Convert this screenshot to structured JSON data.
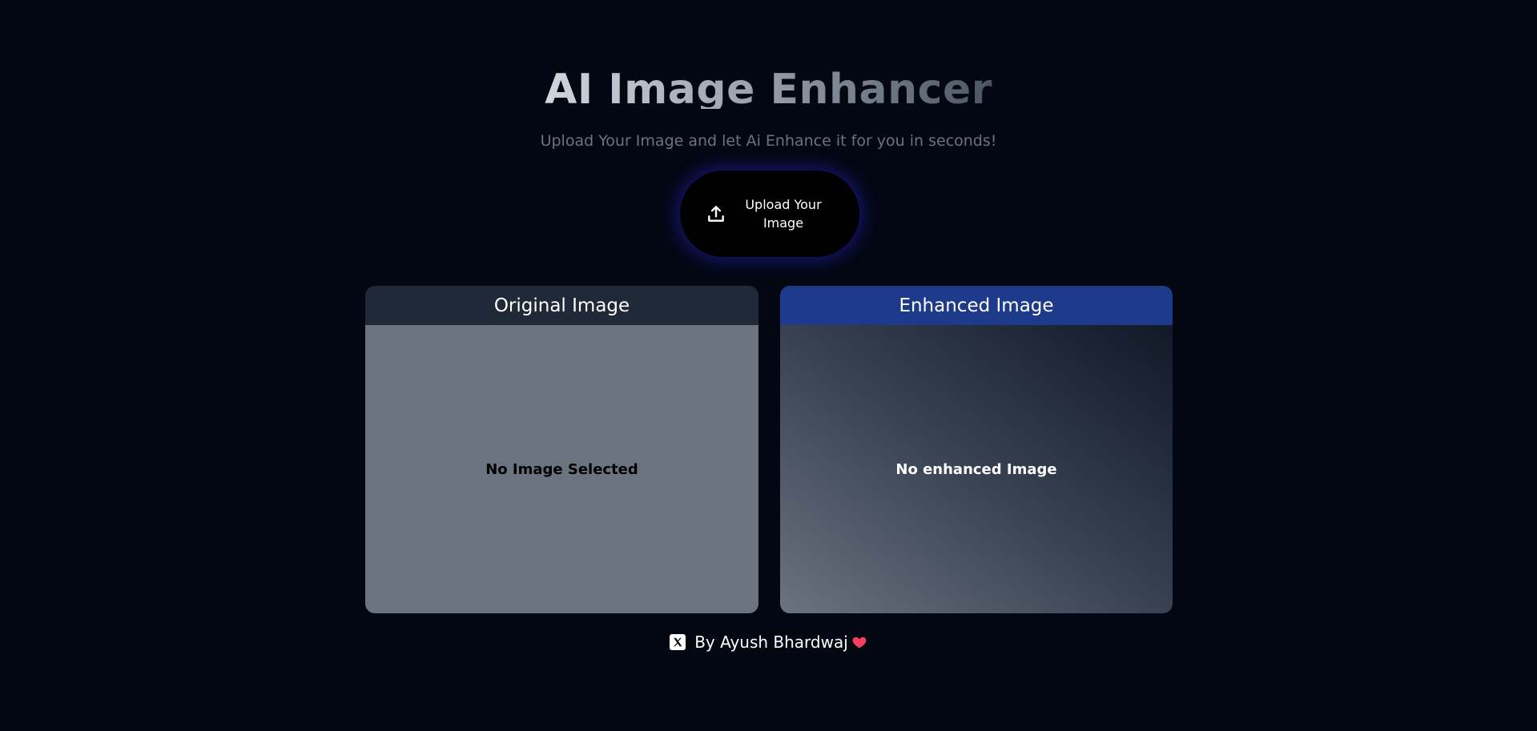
{
  "header": {
    "title": "AI Image Enhancer",
    "subtitle": "Upload Your Image and let Ai Enhance it for you in seconds!"
  },
  "upload": {
    "label": "Upload Your Image",
    "icon": "upload-icon"
  },
  "panels": {
    "original": {
      "title": "Original Image",
      "placeholder": "No Image Selected"
    },
    "enhanced": {
      "title": "Enhanced Image",
      "placeholder": "No enhanced Image"
    }
  },
  "footer": {
    "icon": "x-logo-icon",
    "credit": "By Ayush Bhardwaj",
    "heart_icon": "heart-icon"
  },
  "colors": {
    "background": "#030712",
    "original_header": "#1f2937",
    "enhanced_header": "#1e3a8a",
    "original_body": "#6b7280",
    "button_glow": "#1e1b96",
    "heart": "#f43f5e"
  }
}
